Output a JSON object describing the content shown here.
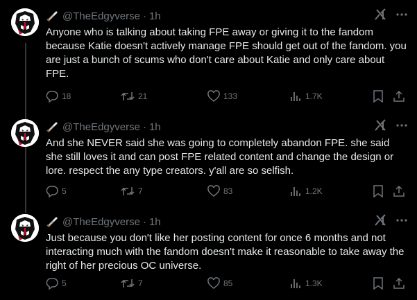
{
  "tweets": [
    {
      "handle": "@TheEdgyverse",
      "separator": "·",
      "time": "1h",
      "text": "Anyone who is talking about taking FPE away or giving it to the fandom because Katie doesn't actively manage FPE should get out of the fandom. you are just a bunch of scums who don't care about Katie and only care about FPE.",
      "replies": "18",
      "retweets": "21",
      "likes": "133",
      "views": "1.7K"
    },
    {
      "handle": "@TheEdgyverse",
      "separator": "·",
      "time": "1h",
      "text": "And she NEVER said she was going to completely abandon FPE. she said she still loves it and can post FPE related content and change the design or lore. respect the any type creators. y'all are so selfish.",
      "replies": "5",
      "retweets": "7",
      "likes": "83",
      "views": "1.2K"
    },
    {
      "handle": "@TheEdgyverse",
      "separator": "·",
      "time": "1h",
      "text": "Just because you don't like her posting content for once 6 months and not interacting much with the fandom doesn't make it reasonable to take away the right of her precious OC universe.",
      "replies": "5",
      "retweets": "7",
      "likes": "85",
      "views": "1.3K"
    }
  ],
  "icons": {
    "avatar": "robot-mask-avatar",
    "name_badge": "knife-icon",
    "grok": "grok-icon",
    "more": "more-icon",
    "reply": "reply-icon",
    "retweet": "retweet-icon",
    "like": "heart-icon",
    "views": "views-icon",
    "bookmark": "bookmark-icon",
    "share": "share-icon"
  },
  "colors": {
    "background": "#000000",
    "text_primary": "#e7e9ea",
    "text_secondary": "#71767b",
    "thread_line": "#333639",
    "avatar_accent": "#c8102e"
  }
}
